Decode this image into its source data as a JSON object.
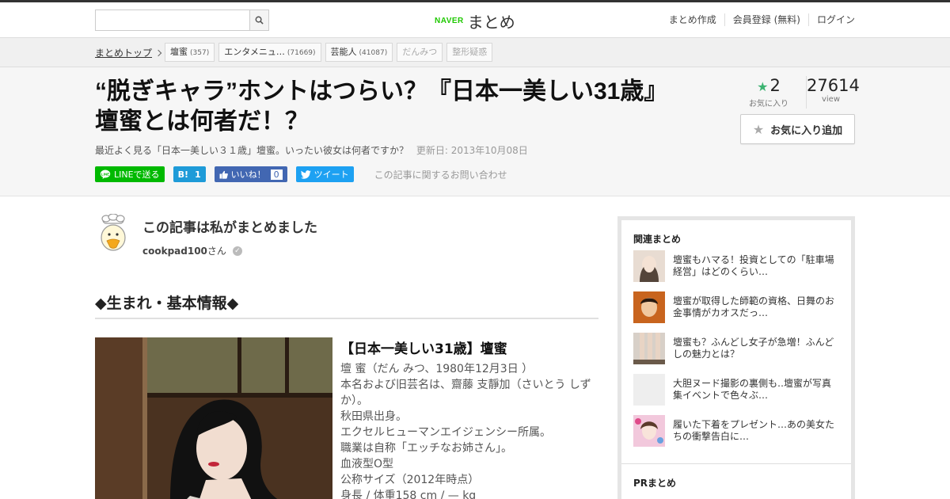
{
  "topbar": {
    "search_placeholder": "",
    "logo_brand": "NAVER",
    "logo_text": "まとめ",
    "nav": [
      "まとめ作成",
      "会員登録 (無料)",
      "ログイン"
    ]
  },
  "breadcrumb": {
    "top": "まとめトップ",
    "tags": [
      {
        "label": "壇蜜",
        "count": "(357)"
      },
      {
        "label": "エンタメニュ…",
        "count": "(71669)"
      },
      {
        "label": "芸能人",
        "count": "(41087)"
      },
      {
        "label": "だんみつ",
        "count": ""
      },
      {
        "label": "整形疑惑",
        "count": ""
      }
    ]
  },
  "article": {
    "title": "“脱ぎキャラ”ホントはつらい？『日本一美しい31歳』壇蜜とは何者だ！？",
    "description": "最近よく見る「日本一美しい３１歳」壇蜜。いったい彼女は何者ですか？",
    "updated": "更新日: 2013年10月08日",
    "share": {
      "line": "LINEで送る",
      "hatena": "B!",
      "hatena_count": "1",
      "fb": "いいね！",
      "fb_count": "0",
      "tweet": "ツイート"
    },
    "inquiry": "この記事に関するお問い合わせ"
  },
  "stats": {
    "favorites": "2",
    "favorites_label": "お気に入り",
    "views": "27614",
    "views_label": "view",
    "fav_button": "お気に入り追加"
  },
  "author": {
    "heading": "この記事は私がまとめました",
    "name": "cookpad100",
    "suffix": "さん"
  },
  "section_heading": "◆生まれ・基本情報◆",
  "profile": {
    "title": "【日本一美しい31歳】壇蜜",
    "lines": [
      "壇 蜜（だん みつ、1980年12月3日 ）",
      "本名および旧芸名は、齋藤 支靜加（さいとう しずか）。",
      "秋田県出身。",
      "エクセルヒューマンエイジェンシー所属。",
      "職業は自称「エッチなお姉さん」。",
      "血液型O型",
      "公称サイズ（2012年時点）",
      "身長 / 体重158 cm / — kg"
    ]
  },
  "sidebar": {
    "related_heading": "関連まとめ",
    "related": [
      "壇蜜もハマる！投資としての「駐車場経営」はどのくらい…",
      "壇蜜が取得した師範の資格、日舞のお金事情がカオスだっ…",
      "壇蜜も？ふんどし女子が急増！ふんどしの魅力とは？",
      "大胆ヌード撮影の裏側も‥壇蜜が写真集イベントで色々ぶ…",
      "履いた下着をプレゼント…あの美女たちの衝撃告白に…"
    ],
    "pr_heading": "PRまとめ"
  },
  "colors": {
    "naver_green": "#1ec800",
    "line_green": "#00b900",
    "hatena_blue": "#1e9bd8",
    "facebook_blue": "#4267b2",
    "twitter_blue": "#1da1f2",
    "star_green": "#3cb371"
  }
}
